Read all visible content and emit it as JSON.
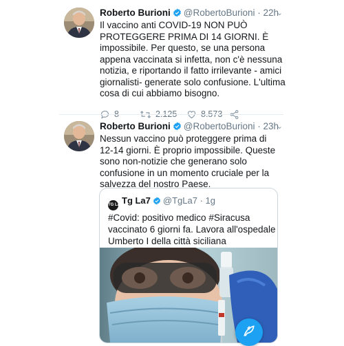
{
  "tweets": [
    {
      "author": "Roberto Burioni",
      "handle": "@RobertoBurioni",
      "time": "22h",
      "lines": [
        "Il vaccino anti COVID-19 NON PUÒ",
        "PROTEGGERE PRIMA DI 14 GIORNI. È",
        "impossibile. Per questo, se una persona",
        "appena vaccinata si infetta, non c'è nessuna",
        "notizia, e riportando il fatto irrilevante - amici",
        "giornalisti- generate solo confusione. L'ultima",
        "cosa di cui abbiamo bisogno."
      ],
      "replies": "8",
      "retweets": "2.125",
      "likes": "8.573"
    },
    {
      "author": "Roberto Burioni",
      "handle": "@RobertoBurioni",
      "time": "23h",
      "lines": [
        "Nessun vaccino può proteggere prima di",
        "12-14 giorni. È proprio impossibile. Queste",
        "sono non-notizie che generano solo",
        "confusione in un momento cruciale per la",
        "salvezza del nostro Paese."
      ],
      "quote": {
        "logo_text": "TG LA7",
        "author": "Tg La7",
        "handle": "@TgLa7",
        "time": "1g",
        "lines": [
          "#Covid: positivo medico #Siracusa",
          "vaccinato 6 giorni fa. Lavora all'ospedale",
          "Umberto I della città siciliana"
        ]
      }
    }
  ],
  "dot": "·",
  "colors": {
    "accent": "#1da1f2",
    "muted": "#657786",
    "border": "#e6ecf0"
  },
  "icons": [
    "verified-badge-icon",
    "chevron-down-icon",
    "reply-icon",
    "retweet-icon",
    "like-icon",
    "share-icon",
    "compose-tweet-icon"
  ]
}
